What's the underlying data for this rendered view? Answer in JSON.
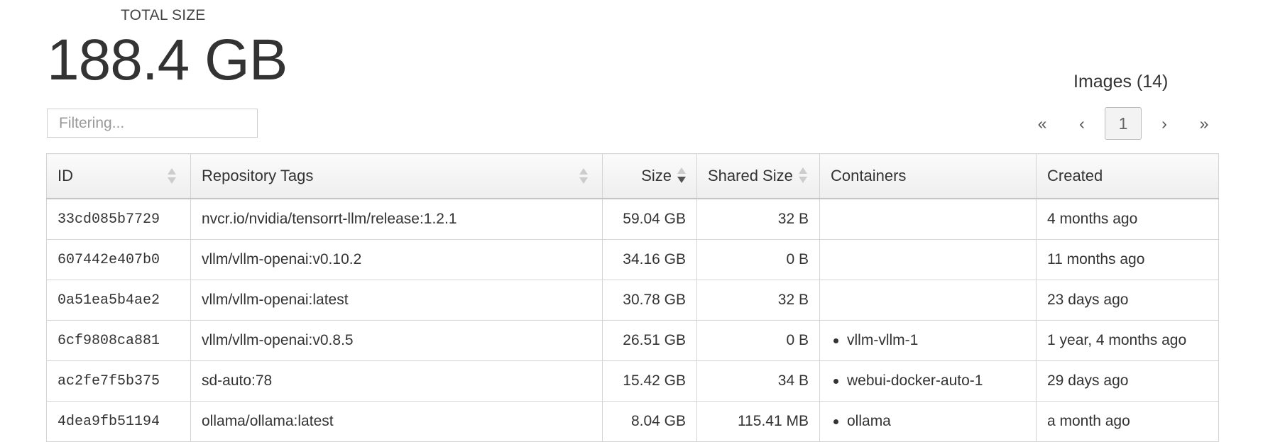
{
  "summary": {
    "label": "TOTAL SIZE",
    "value": "188.4 GB"
  },
  "filter": {
    "placeholder": "Filtering...",
    "value": ""
  },
  "images_title": "Images (14)",
  "pagination": {
    "first": "«",
    "prev": "‹",
    "current": "1",
    "next": "›",
    "last": "»"
  },
  "table": {
    "columns": {
      "id": "ID",
      "tags": "Repository Tags",
      "size": "Size",
      "shared": "Shared Size",
      "containers": "Containers",
      "created": "Created"
    },
    "rows": [
      {
        "id": "33cd085b7729",
        "tags": "nvcr.io/nvidia/tensorrt-llm/release:1.2.1",
        "size": "59.04 GB",
        "shared": "32 B",
        "container": "",
        "created": "4 months ago"
      },
      {
        "id": "607442e407b0",
        "tags": "vllm/vllm-openai:v0.10.2",
        "size": "34.16 GB",
        "shared": "0 B",
        "container": "",
        "created": "11 months ago"
      },
      {
        "id": "0a51ea5b4ae2",
        "tags": "vllm/vllm-openai:latest",
        "size": "30.78 GB",
        "shared": "32 B",
        "container": "",
        "created": "23 days ago"
      },
      {
        "id": "6cf9808ca881",
        "tags": "vllm/vllm-openai:v0.8.5",
        "size": "26.51 GB",
        "shared": "0 B",
        "container": "vllm-vllm-1",
        "created": "1 year, 4 months ago"
      },
      {
        "id": "ac2fe7f5b375",
        "tags": "sd-auto:78",
        "size": "15.42 GB",
        "shared": "34 B",
        "container": "webui-docker-auto-1",
        "created": "29 days ago"
      },
      {
        "id": "4dea9fb51194",
        "tags": "ollama/ollama:latest",
        "size": "8.04 GB",
        "shared": "115.41 MB",
        "container": "ollama",
        "created": "a month ago"
      }
    ]
  }
}
